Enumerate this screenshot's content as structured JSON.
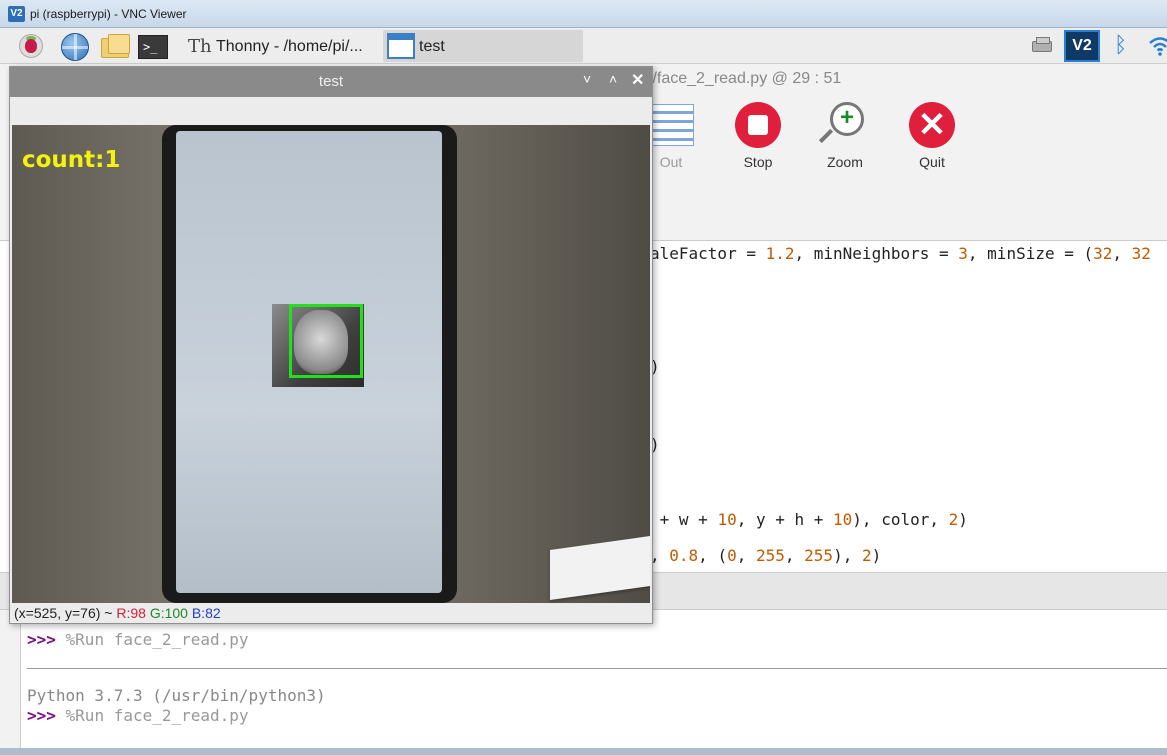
{
  "vnc": {
    "logo": "V2",
    "title": "pi (raspberrypi) - VNC Viewer"
  },
  "taskbar": {
    "terminal_glyph": ">_",
    "thonny_icon_glyph": "Th",
    "thonny_label": "Thonny  -  /home/pi/...",
    "test_label": "test",
    "tray_vnc_logo": "V2",
    "tray_bluetooth_glyph": "ᛒ"
  },
  "thonny": {
    "title_fragment": "ct/face_2_read.py  @  29 : 51",
    "toolbar": {
      "out_label": "Out",
      "stop_label": "Stop",
      "zoom_label": "Zoom",
      "quit_label": "Quit",
      "quit_glyph": "✕"
    },
    "code": {
      "line1_a": "aleFactor = ",
      "line1_n1": "1.2",
      "line1_b": ", minNeighbors = ",
      "line1_n2": "3",
      "line1_c": ", minSize = (",
      "line1_n3": "32",
      "line1_d": ", ",
      "line1_n4": "32",
      "line2": ")",
      "line3": ")",
      "line4_a": " + w + ",
      "line4_n1": "10",
      "line4_b": ", y + h + ",
      "line4_n2": "10",
      "line4_c": "), color, ",
      "line4_n3": "2",
      "line4_d": ")",
      "line5_a": ", ",
      "line5_n1": "0.8",
      "line5_b": ", (",
      "line5_n2": "0",
      "line5_c": ", ",
      "line5_n3": "255",
      "line5_d": ", ",
      "line5_n4": "255",
      "line5_e": "), ",
      "line5_n5": "2",
      "line5_f": ")"
    },
    "shell": {
      "prompt": ">>>",
      "line1_cmd": " %Run face_2_read.py",
      "line2": "Python 3.7.3 (/usr/bin/python3)",
      "line3_cmd": " %Run face_2_read.py"
    }
  },
  "test_window": {
    "title": "test",
    "min_glyph": "˅",
    "max_glyph": "˄",
    "close_glyph": "✕",
    "overlay_text": "count:1",
    "status": {
      "coords": "(x=525, y=76) ~ ",
      "r": "R:98",
      "g": "G:100",
      "b": "B:82"
    }
  },
  "colors": {
    "overlay_text": "#f4f40a",
    "detection_box": "#22e01c",
    "stop_button": "#e01f3d",
    "quit_button": "#e01f3d",
    "vnc_blue": "#2b6fb6"
  },
  "icons": [
    "raspberry-pi-menu-icon",
    "web-browser-globe-icon",
    "file-manager-folder-icon",
    "terminal-icon",
    "thonny-icon",
    "window-icon",
    "printer-icon",
    "vnc-icon",
    "bluetooth-icon",
    "wifi-icon",
    "stop-icon",
    "zoom-icon",
    "quit-icon",
    "out-icon"
  ]
}
